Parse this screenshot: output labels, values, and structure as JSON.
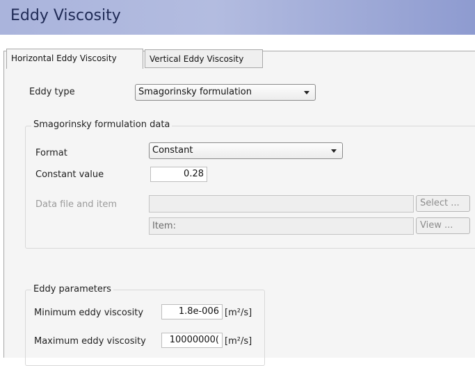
{
  "window": {
    "title": "Eddy Viscosity"
  },
  "tabs": [
    {
      "label": "Horizontal Eddy Viscosity",
      "active": true
    },
    {
      "label": "Vertical Eddy Viscosity",
      "active": false
    }
  ],
  "eddy_type": {
    "label": "Eddy type",
    "value": "Smagorinsky formulation"
  },
  "smagorinsky": {
    "group_title": "Smagorinsky formulation data",
    "format_label": "Format",
    "format_value": "Constant",
    "constant_label": "Constant value",
    "constant_value": "0.28",
    "datafile_label": "Data file and item",
    "datafile_value": "",
    "item_value": "Item:",
    "select_button": "Select ...",
    "view_button": "View ..."
  },
  "eddy_params": {
    "group_title": "Eddy parameters",
    "min_label": "Minimum eddy viscosity",
    "min_value": "1.8e-006",
    "min_unit": "[m²/s]",
    "max_label": "Maximum eddy viscosity",
    "max_value": "10000000(",
    "max_unit": "[m²/s]"
  }
}
